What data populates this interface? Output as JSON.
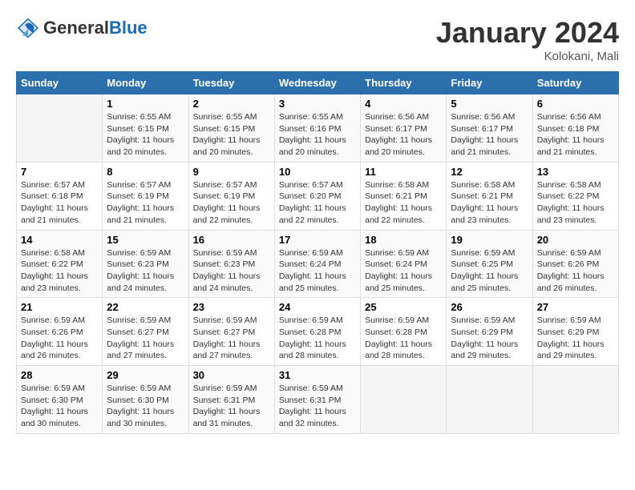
{
  "header": {
    "logo_line1": "General",
    "logo_line2": "Blue",
    "month_title": "January 2024",
    "location": "Kolokani, Mali"
  },
  "weekdays": [
    "Sunday",
    "Monday",
    "Tuesday",
    "Wednesday",
    "Thursday",
    "Friday",
    "Saturday"
  ],
  "weeks": [
    [
      {
        "day": "",
        "info": ""
      },
      {
        "day": "1",
        "info": "Sunrise: 6:55 AM\nSunset: 6:15 PM\nDaylight: 11 hours\nand 20 minutes."
      },
      {
        "day": "2",
        "info": "Sunrise: 6:55 AM\nSunset: 6:15 PM\nDaylight: 11 hours\nand 20 minutes."
      },
      {
        "day": "3",
        "info": "Sunrise: 6:55 AM\nSunset: 6:16 PM\nDaylight: 11 hours\nand 20 minutes."
      },
      {
        "day": "4",
        "info": "Sunrise: 6:56 AM\nSunset: 6:17 PM\nDaylight: 11 hours\nand 20 minutes."
      },
      {
        "day": "5",
        "info": "Sunrise: 6:56 AM\nSunset: 6:17 PM\nDaylight: 11 hours\nand 21 minutes."
      },
      {
        "day": "6",
        "info": "Sunrise: 6:56 AM\nSunset: 6:18 PM\nDaylight: 11 hours\nand 21 minutes."
      }
    ],
    [
      {
        "day": "7",
        "info": "Sunrise: 6:57 AM\nSunset: 6:18 PM\nDaylight: 11 hours\nand 21 minutes."
      },
      {
        "day": "8",
        "info": "Sunrise: 6:57 AM\nSunset: 6:19 PM\nDaylight: 11 hours\nand 21 minutes."
      },
      {
        "day": "9",
        "info": "Sunrise: 6:57 AM\nSunset: 6:19 PM\nDaylight: 11 hours\nand 22 minutes."
      },
      {
        "day": "10",
        "info": "Sunrise: 6:57 AM\nSunset: 6:20 PM\nDaylight: 11 hours\nand 22 minutes."
      },
      {
        "day": "11",
        "info": "Sunrise: 6:58 AM\nSunset: 6:21 PM\nDaylight: 11 hours\nand 22 minutes."
      },
      {
        "day": "12",
        "info": "Sunrise: 6:58 AM\nSunset: 6:21 PM\nDaylight: 11 hours\nand 23 minutes."
      },
      {
        "day": "13",
        "info": "Sunrise: 6:58 AM\nSunset: 6:22 PM\nDaylight: 11 hours\nand 23 minutes."
      }
    ],
    [
      {
        "day": "14",
        "info": "Sunrise: 6:58 AM\nSunset: 6:22 PM\nDaylight: 11 hours\nand 23 minutes."
      },
      {
        "day": "15",
        "info": "Sunrise: 6:59 AM\nSunset: 6:23 PM\nDaylight: 11 hours\nand 24 minutes."
      },
      {
        "day": "16",
        "info": "Sunrise: 6:59 AM\nSunset: 6:23 PM\nDaylight: 11 hours\nand 24 minutes."
      },
      {
        "day": "17",
        "info": "Sunrise: 6:59 AM\nSunset: 6:24 PM\nDaylight: 11 hours\nand 25 minutes."
      },
      {
        "day": "18",
        "info": "Sunrise: 6:59 AM\nSunset: 6:24 PM\nDaylight: 11 hours\nand 25 minutes."
      },
      {
        "day": "19",
        "info": "Sunrise: 6:59 AM\nSunset: 6:25 PM\nDaylight: 11 hours\nand 25 minutes."
      },
      {
        "day": "20",
        "info": "Sunrise: 6:59 AM\nSunset: 6:26 PM\nDaylight: 11 hours\nand 26 minutes."
      }
    ],
    [
      {
        "day": "21",
        "info": "Sunrise: 6:59 AM\nSunset: 6:26 PM\nDaylight: 11 hours\nand 26 minutes."
      },
      {
        "day": "22",
        "info": "Sunrise: 6:59 AM\nSunset: 6:27 PM\nDaylight: 11 hours\nand 27 minutes."
      },
      {
        "day": "23",
        "info": "Sunrise: 6:59 AM\nSunset: 6:27 PM\nDaylight: 11 hours\nand 27 minutes."
      },
      {
        "day": "24",
        "info": "Sunrise: 6:59 AM\nSunset: 6:28 PM\nDaylight: 11 hours\nand 28 minutes."
      },
      {
        "day": "25",
        "info": "Sunrise: 6:59 AM\nSunset: 6:28 PM\nDaylight: 11 hours\nand 28 minutes."
      },
      {
        "day": "26",
        "info": "Sunrise: 6:59 AM\nSunset: 6:29 PM\nDaylight: 11 hours\nand 29 minutes."
      },
      {
        "day": "27",
        "info": "Sunrise: 6:59 AM\nSunset: 6:29 PM\nDaylight: 11 hours\nand 29 minutes."
      }
    ],
    [
      {
        "day": "28",
        "info": "Sunrise: 6:59 AM\nSunset: 6:30 PM\nDaylight: 11 hours\nand 30 minutes."
      },
      {
        "day": "29",
        "info": "Sunrise: 6:59 AM\nSunset: 6:30 PM\nDaylight: 11 hours\nand 30 minutes."
      },
      {
        "day": "30",
        "info": "Sunrise: 6:59 AM\nSunset: 6:31 PM\nDaylight: 11 hours\nand 31 minutes."
      },
      {
        "day": "31",
        "info": "Sunrise: 6:59 AM\nSunset: 6:31 PM\nDaylight: 11 hours\nand 32 minutes."
      },
      {
        "day": "",
        "info": ""
      },
      {
        "day": "",
        "info": ""
      },
      {
        "day": "",
        "info": ""
      }
    ]
  ]
}
